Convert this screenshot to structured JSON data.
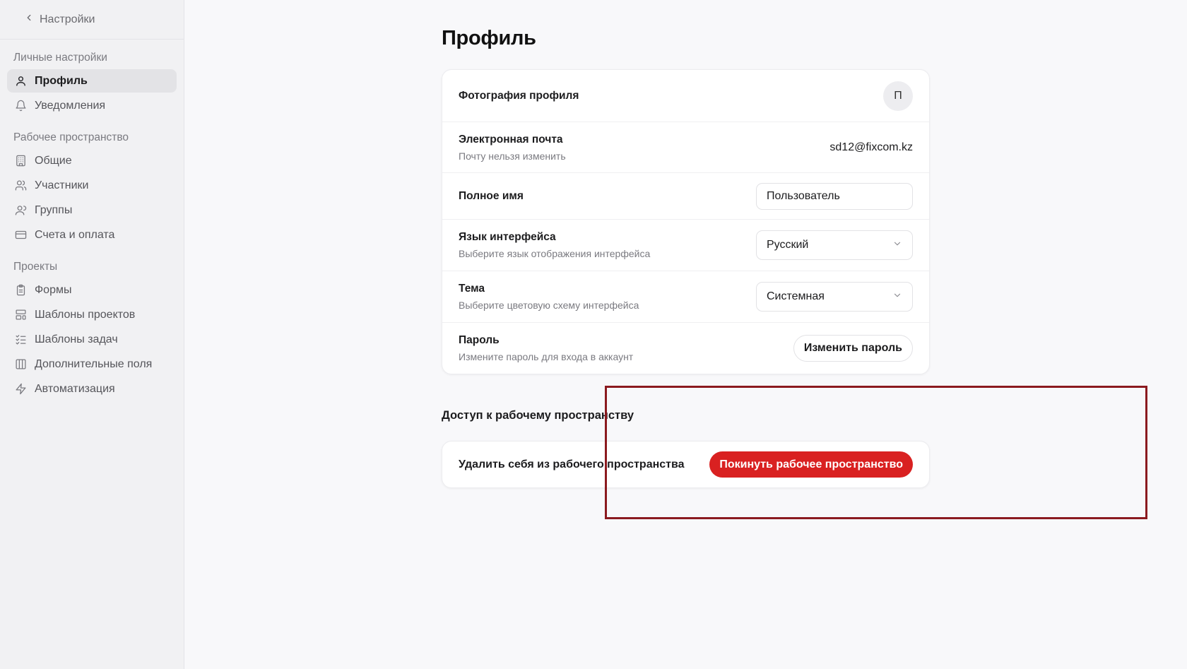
{
  "sidebar": {
    "back_label": "Настройки",
    "sections": [
      {
        "title": "Личные настройки",
        "items": [
          {
            "label": "Профиль",
            "icon": "user-icon",
            "active": true
          },
          {
            "label": "Уведомления",
            "icon": "bell-icon",
            "active": false
          }
        ]
      },
      {
        "title": "Рабочее пространство",
        "items": [
          {
            "label": "Общие",
            "icon": "building-icon"
          },
          {
            "label": "Участники",
            "icon": "users-icon"
          },
          {
            "label": "Группы",
            "icon": "group-icon"
          },
          {
            "label": "Счета и оплата",
            "icon": "credit-card-icon"
          }
        ]
      },
      {
        "title": "Проекты",
        "items": [
          {
            "label": "Формы",
            "icon": "clipboard-icon"
          },
          {
            "label": "Шаблоны проектов",
            "icon": "layout-template-icon"
          },
          {
            "label": "Шаблоны задач",
            "icon": "list-checks-icon"
          },
          {
            "label": "Дополнительные поля",
            "icon": "columns-icon"
          },
          {
            "label": "Автоматизация",
            "icon": "zap-icon"
          }
        ]
      }
    ]
  },
  "main": {
    "title": "Профиль",
    "profile": {
      "photo_label": "Фотография профиля",
      "avatar_initial": "П",
      "email_label": "Электронная почта",
      "email_sub": "Почту нельзя изменить",
      "email_value": "sd12@fixcom.kz",
      "fullname_label": "Полное имя",
      "fullname_value": "Пользователь",
      "language_label": "Язык интерфейса",
      "language_sub": "Выберите язык отображения интерфейса",
      "language_value": "Русский",
      "theme_label": "Тема",
      "theme_sub": "Выберите цветовую схему интерфейса",
      "theme_value": "Системная",
      "password_label": "Пароль",
      "password_sub": "Измените пароль для входа в аккаунт",
      "password_button": "Изменить пароль"
    },
    "access": {
      "title": "Доступ к рабочему пространству",
      "label": "Удалить себя из рабочего пространства",
      "button": "Покинуть рабочее пространство"
    }
  },
  "colors": {
    "danger": "#d92121",
    "highlight_border": "#8b1a1f",
    "sidebar_bg": "#f1f1f3"
  }
}
